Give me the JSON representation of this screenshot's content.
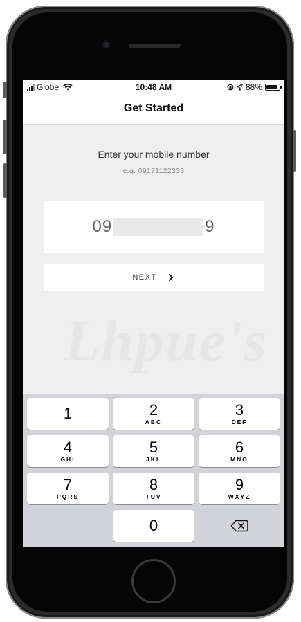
{
  "status_bar": {
    "carrier": "Globe",
    "time": "10:48 AM",
    "battery": "88%",
    "battery_level": 0.88
  },
  "navbar": {
    "title": "Get Started"
  },
  "form": {
    "prompt": "Enter your mobile number",
    "example": "e.g. 09171122333",
    "phone_prefix": "09",
    "phone_suffix": "9",
    "next_label": "NEXT"
  },
  "watermark": {
    "text": "Lhpue's"
  },
  "keypad": {
    "keys": [
      {
        "num": "1",
        "letters": ""
      },
      {
        "num": "2",
        "letters": "ABC"
      },
      {
        "num": "3",
        "letters": "DEF"
      },
      {
        "num": "4",
        "letters": "GHI"
      },
      {
        "num": "5",
        "letters": "JKL"
      },
      {
        "num": "6",
        "letters": "MNO"
      },
      {
        "num": "7",
        "letters": "PQRS"
      },
      {
        "num": "8",
        "letters": "TUV"
      },
      {
        "num": "9",
        "letters": "WXYZ"
      },
      {
        "num": "0",
        "letters": ""
      }
    ],
    "delete_icon": "backspace-icon"
  },
  "colors": {
    "screen_bg": "#efefef",
    "keypad_bg": "#d1d3d9",
    "key_bg": "#ffffff"
  }
}
